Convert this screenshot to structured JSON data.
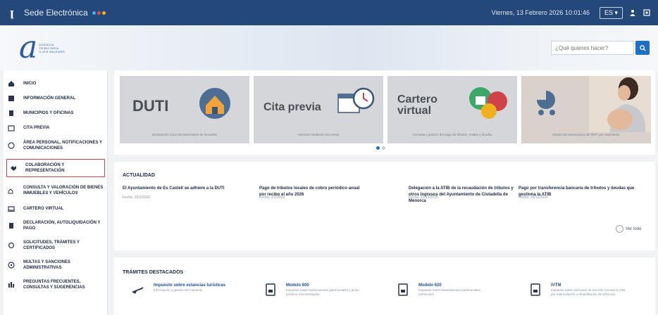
{
  "topbar": {
    "title": "Sede Electrónica",
    "date": "Viernes, 13 Febrero 2026 10:01:46",
    "lang": "ES ▾"
  },
  "colors": {
    "topbar": "#24487a",
    "accent": "#1f6fc5",
    "active_border": "#d0424a"
  },
  "header": {
    "agency_lines": [
      "AGENCIA",
      "TRIBUTARIA",
      "ILLES BALEARS"
    ],
    "search_placeholder": "¿Qué quieres hacer?"
  },
  "sidebar": {
    "items": [
      {
        "label": "Inicio",
        "icon": "home-icon"
      },
      {
        "label": "Información general",
        "icon": "info-icon"
      },
      {
        "label": "Municipios y oficinas",
        "icon": "building-icon"
      },
      {
        "label": "Cita previa",
        "icon": "calendar-icon"
      },
      {
        "label": "Área personal, notificaciones y comunicaciones",
        "icon": "user-icon"
      },
      {
        "label": "Colaboración y representación",
        "icon": "handshake-icon"
      },
      {
        "label": "Consulta y valoración de bienes inmuebles y vehículos",
        "icon": "house-car-icon"
      },
      {
        "label": "Cartero virtual",
        "icon": "laptop-icon"
      },
      {
        "label": "Declaración, autoliquidación y pago",
        "icon": "document-icon"
      },
      {
        "label": "Solicitudes, trámites y certificados",
        "icon": "certificate-icon"
      },
      {
        "label": "Multas y sanciones administrativas",
        "icon": "warning-icon"
      },
      {
        "label": "Preguntas frecuentes, consultas y sugerencias",
        "icon": "question-icon"
      }
    ]
  },
  "banner": {
    "cards": [
      {
        "title": "DUTI",
        "sub": "Declaración única de transmisión de inmueble"
      },
      {
        "title": "Cita previa",
        "sub": "Atención mediante cita previa"
      },
      {
        "title": "Cartero virtual",
        "sub": "Consulta y gestión del pago de tributos, multas y deudas"
      },
      {
        "title": "",
        "sub": "Deducción autonómica del IRPF por nacimiento"
      }
    ]
  },
  "news": {
    "heading": "Actualidad",
    "items": [
      {
        "title": "El Ayuntamiento de Es Castell se adhiere a la DUTI",
        "date": "Fecha: 15/1/2026"
      },
      {
        "title": "Pago de tributos locales de cobro periódico anual por recibo el año 2026",
        "date": "Fecha: 1/1/2026"
      },
      {
        "title": "Delegación a la ATIB de la recaudación de tributos y otros ingresos del Ayuntamiento de Ciutadella de Menorca",
        "date": "Fecha: 31/12/2025"
      },
      {
        "title": "Pago por transferencia bancaria de tributos y deudas que gestiona la ATIB",
        "date": "Fecha: 16/12/2025"
      }
    ],
    "ver_todo": "Ver todo"
  },
  "tramites": {
    "heading": "Trámites destacados",
    "items": [
      {
        "title": "Impuesto sobre estancias turísticas",
        "desc": "Información y gestión del impuesto",
        "icon": "plane-icon"
      },
      {
        "title": "Modelo 600",
        "desc": "Impuesto sobre transmisiones patrimoniales y actos jurídicos documentados",
        "icon": "form-icon"
      },
      {
        "title": "Modelo 620",
        "desc": "Impuesto sobre transmisiones patrimoniales (vehículos)",
        "icon": "form-icon"
      },
      {
        "title": "IVTM",
        "desc": "Impuesto sobre vehículos de tracción mecánica (Alta por matriculación o rehabilitación de vehículo)",
        "icon": "form-icon"
      }
    ]
  }
}
